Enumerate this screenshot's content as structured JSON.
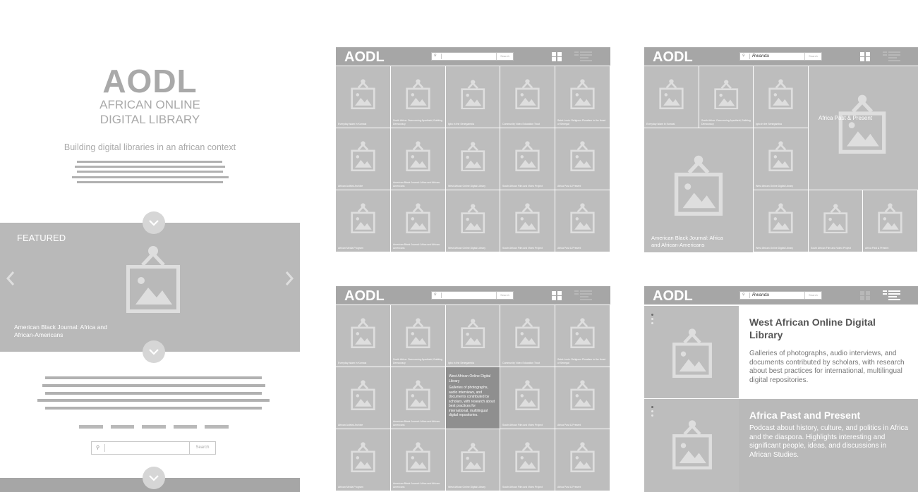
{
  "landing": {
    "logo": "AODL",
    "subtitle_line1": "AFRICAN ONLINE",
    "subtitle_line2": "DIGITAL LIBRARY",
    "tagline": "Building digital libraries in an african context",
    "featured": {
      "label": "FEATURED",
      "caption": "American Black Journal: Africa and African-Americans"
    },
    "search": {
      "button": "Search",
      "value": ""
    }
  },
  "panels": {
    "logo": "AODL",
    "search_button": "Search",
    "search_value_filtered": "Rwanda",
    "tile_captions": [
      "Everyday Islam in Kumasi",
      "South Africa: Overcoming Apartheid, Building Democracy",
      "Igbo in the Senegambia",
      "Community Video Education Trust",
      "Saint-Louis: Religious Pluralism in the Heart of Senegal",
      "African Activist Archive",
      "American Black Journal: Africa and African-Americans",
      "West African Online Digital Library",
      "South African Film and Video Project",
      "Africa Past & Present",
      "African Media Program",
      "American Black Journal: Africa and African-Americans",
      "West African Online Digital Library",
      "South African Film and Video Project",
      "Africa Past & Present"
    ],
    "filtered": {
      "large_africa": "Africa Past & Present",
      "large_abj": "American Black Journal: Africa and African-Americans",
      "small_captions": [
        "Everyday Islam in Kumasi",
        "South Africa: Overcoming Apartheid, Building Democracy",
        "Igbo in the Senegambia",
        "West African Online Digital Library",
        "West African Online Digital Library",
        "South African Film and Video Project",
        "Africa Past & Present"
      ]
    },
    "hover": {
      "title": "West African Online Digital Library",
      "description": "Galleries of photographs, audio interviews, and documents contributed by scholars, with research about best practices for international, multilingual digital repositories."
    },
    "detail": [
      {
        "title": "West African Online Digital Library",
        "description": "Galleries of photographs, audio interviews, and documents contributed by scholars, with research about best practices for international, multilingual digital repositories."
      },
      {
        "title": "Africa Past and Present",
        "description": "Podcast about history, culture, and politics in Africa and the diaspora. Highlights interesting and significant people, ideas, and discussions in African Studies."
      }
    ]
  },
  "colors": {
    "header": "#a6a6a6",
    "tile": "#bdbdbd",
    "tile_hover": "#8f8f8f",
    "featured_bg": "#b9b9b9",
    "detail_active_bg": "#ffffff",
    "detail_inactive_bg": "#b9b9b9",
    "title_dark": "#555555",
    "icon_light": "#dedede"
  },
  "icons": {
    "image_placeholder": "picture-frame-icon",
    "grid_view": "grid-view-icon",
    "list_view": "list-view-icon",
    "scroll_down": "chevron-down-icon",
    "prev": "chevron-left-icon",
    "next": "chevron-right-icon",
    "search": "magnifier-icon"
  }
}
